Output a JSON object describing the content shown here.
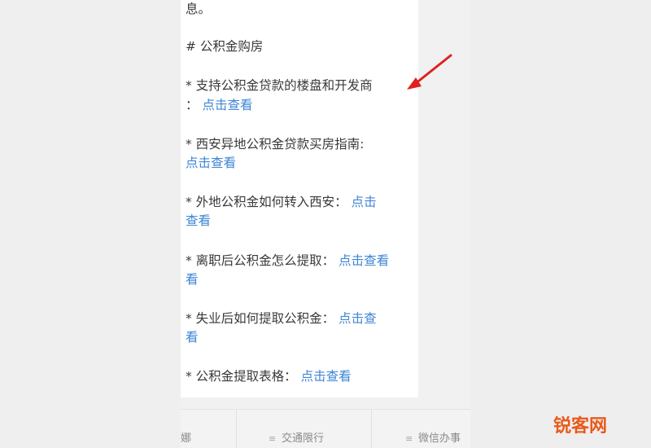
{
  "article": {
    "line_top_fragment": "息。",
    "section_heading": "# 公积金购房",
    "items": [
      {
        "text_line1": "* 支持公积金贷款的楼盘和开发商",
        "prefix_line2": "：",
        "link": "点击查看"
      },
      {
        "text_line1": "* 西安异地公积金贷款买房指南:",
        "link": "点击查看"
      },
      {
        "text_line1": "* 外地公积金如何转入西安：",
        "link_part1": "点击",
        "link_part2": "查看"
      },
      {
        "text_line1": "* 离职后公积金怎么提取：",
        "link_part1": "点击查看",
        "link_part2": "看"
      },
      {
        "text_line1": "* 失业后如何提取公积金：",
        "link_part1": "点击查",
        "link_part2": "看"
      },
      {
        "text_line1": "* 公积金提取表格：",
        "link": "点击查看"
      }
    ]
  },
  "bottom_bar": {
    "item_left_fragment": "娜",
    "item_traffic": "交通限行",
    "item_wechat": "微信办事"
  },
  "watermark": {
    "text": "锐客网"
  },
  "colors": {
    "link": "#3f86d6",
    "text": "#3a3a3a",
    "arrow": "#e02020",
    "watermark": "#e85a1b"
  }
}
